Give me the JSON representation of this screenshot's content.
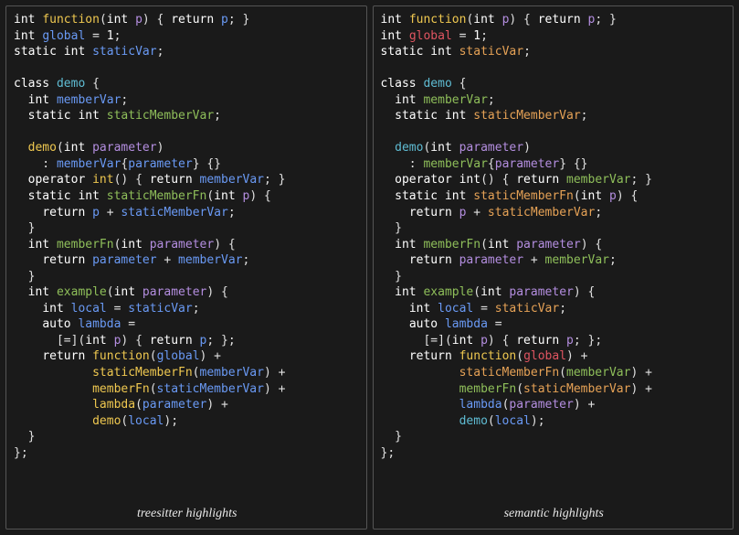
{
  "left": {
    "caption": "treesitter highlights",
    "t": {
      "int": "int",
      "static": "static",
      "class": "class",
      "return": "return",
      "operator": "operator",
      "auto": "auto",
      "function": "function",
      "global": "global",
      "one": "1",
      "staticVar": "staticVar",
      "demo": "demo",
      "memberVar": "memberVar",
      "staticMemberVar": "staticMemberVar",
      "parameter": "parameter",
      "p": "p",
      "staticMemberFn": "staticMemberFn",
      "memberFn": "memberFn",
      "example": "example",
      "local": "local",
      "lambda": "lambda"
    }
  },
  "right": {
    "caption": "semantic highlights",
    "t": {
      "int": "int",
      "static": "static",
      "class": "class",
      "return": "return",
      "operator": "operator",
      "auto": "auto",
      "function": "function",
      "global": "global",
      "one": "1",
      "staticVar": "staticVar",
      "demo": "demo",
      "memberVar": "memberVar",
      "staticMemberVar": "staticMemberVar",
      "parameter": "parameter",
      "p": "p",
      "staticMemberFn": "staticMemberFn",
      "memberFn": "memberFn",
      "example": "example",
      "local": "local",
      "lambda": "lambda"
    }
  }
}
